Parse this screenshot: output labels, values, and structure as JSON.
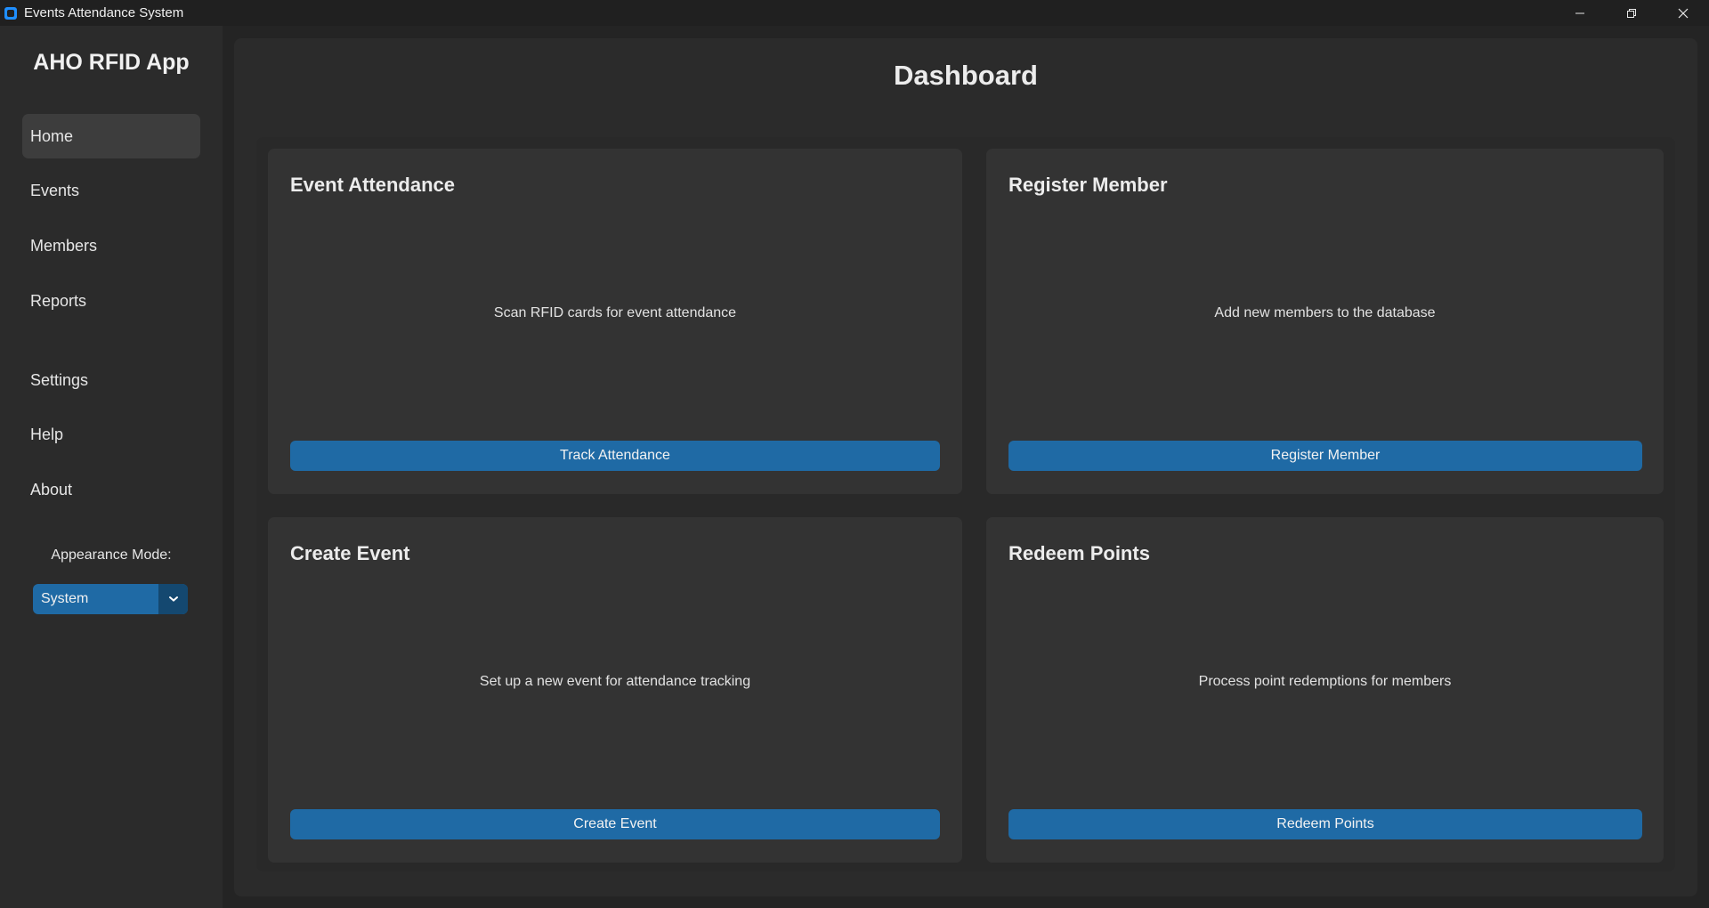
{
  "window": {
    "title": "Events Attendance System",
    "controls": [
      "minimize",
      "restore",
      "close"
    ]
  },
  "sidebar": {
    "brand": "AHO RFID App",
    "items": [
      {
        "label": "Home",
        "active": true
      },
      {
        "label": "Events",
        "active": false
      },
      {
        "label": "Members",
        "active": false
      },
      {
        "label": "Reports",
        "active": false
      },
      {
        "label": "Settings",
        "active": false
      },
      {
        "label": "Help",
        "active": false
      },
      {
        "label": "About",
        "active": false
      }
    ],
    "appearance_label": "Appearance Mode:",
    "appearance_value": "System"
  },
  "main": {
    "title": "Dashboard",
    "cards": [
      {
        "title": "Event Attendance",
        "description": "Scan RFID cards for event attendance",
        "button": "Track Attendance"
      },
      {
        "title": "Register Member",
        "description": "Add new members to the database",
        "button": "Register Member"
      },
      {
        "title": "Create Event",
        "description": "Set up a new event for attendance tracking",
        "button": "Create Event"
      },
      {
        "title": "Redeem Points",
        "description": "Process point redemptions for members",
        "button": "Redeem Points"
      }
    ]
  },
  "colors": {
    "accent": "#1f6aa5",
    "accent_dark": "#144870",
    "background": "#242424",
    "panel": "#2b2b2b",
    "card": "#333333"
  }
}
